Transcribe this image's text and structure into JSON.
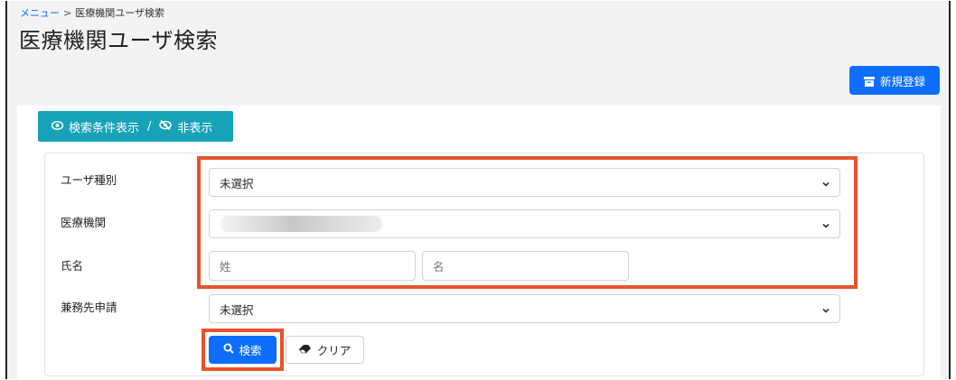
{
  "breadcrumb": {
    "menu": "メニュー",
    "separator": ">",
    "current": "医療機関ユーザ検索"
  },
  "page": {
    "title": "医療機関ユーザ検索"
  },
  "header": {
    "new_button_label": "新規登録"
  },
  "toggle": {
    "show_label": "検索条件表示",
    "slash": "/",
    "hide_label": "非表示"
  },
  "form": {
    "user_type": {
      "label": "ユーザ種別",
      "value": "未選択"
    },
    "institution": {
      "label": "医療機関"
    },
    "name": {
      "label": "氏名",
      "last_placeholder": "姓",
      "first_placeholder": "名"
    },
    "concurrent": {
      "label": "兼務先申請",
      "value": "未選択"
    }
  },
  "actions": {
    "search_label": "検索",
    "clear_label": "クリア"
  },
  "colors": {
    "primary": "#0d6efd",
    "info": "#17a2b8",
    "highlight": "#e8532b"
  }
}
